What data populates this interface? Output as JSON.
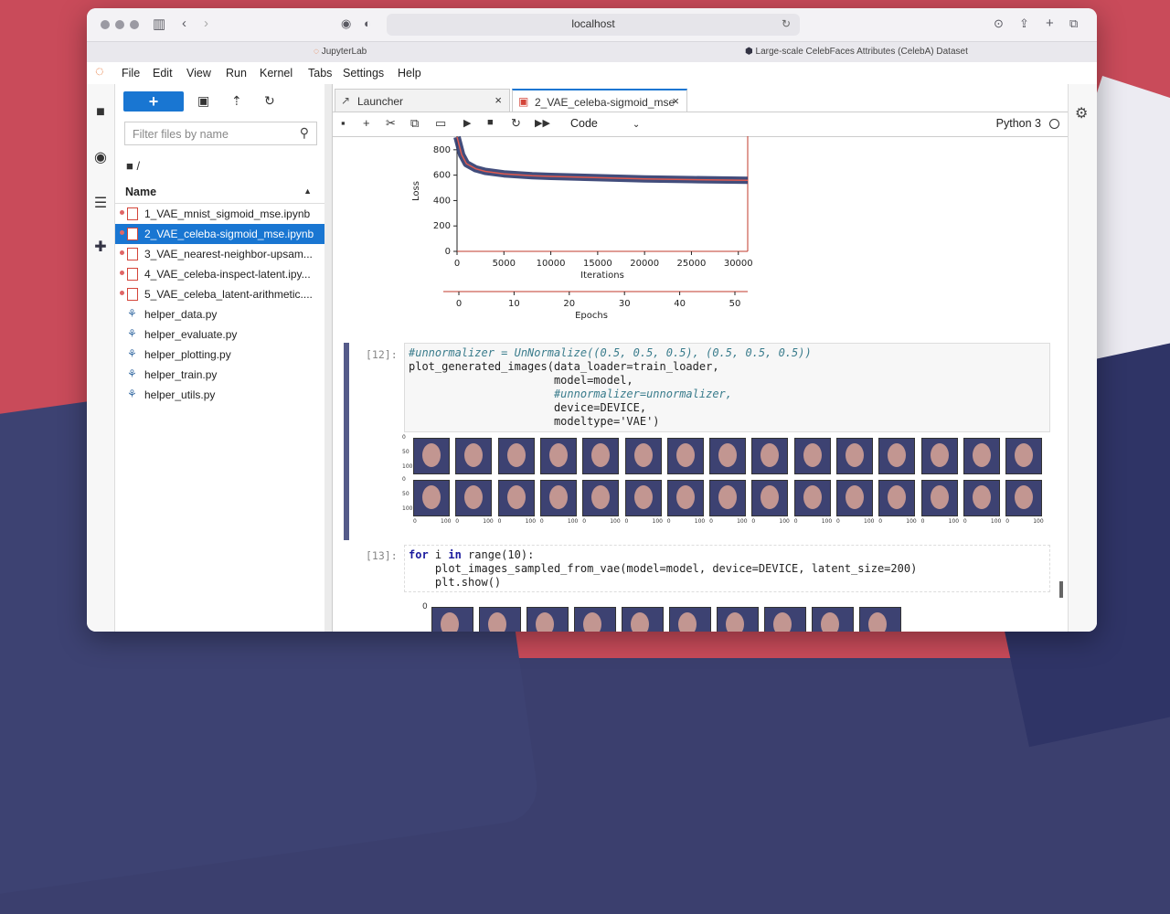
{
  "browser": {
    "url": "localhost",
    "tab_left": "JupyterLab",
    "tab_right": "Large-scale CelebFaces Attributes (CelebA) Dataset"
  },
  "menu": [
    "File",
    "Edit",
    "View",
    "Run",
    "Kernel",
    "Tabs",
    "Settings",
    "Help"
  ],
  "file_browser": {
    "filter_placeholder": "Filter files by name",
    "path": "/",
    "column_name": "Name",
    "files": [
      {
        "name": "1_VAE_mnist_sigmoid_mse.ipynb",
        "type": "notebook",
        "running": true,
        "selected": false
      },
      {
        "name": "2_VAE_celeba-sigmoid_mse.ipynb",
        "type": "notebook",
        "running": true,
        "selected": true
      },
      {
        "name": "3_VAE_nearest-neighbor-upsam...",
        "type": "notebook",
        "running": true,
        "selected": false
      },
      {
        "name": "4_VAE_celeba-inspect-latent.ipy...",
        "type": "notebook",
        "running": true,
        "selected": false
      },
      {
        "name": "5_VAE_celeba_latent-arithmetic....",
        "type": "notebook",
        "running": true,
        "selected": false
      },
      {
        "name": "helper_data.py",
        "type": "python"
      },
      {
        "name": "helper_evaluate.py",
        "type": "python"
      },
      {
        "name": "helper_plotting.py",
        "type": "python"
      },
      {
        "name": "helper_train.py",
        "type": "python"
      },
      {
        "name": "helper_utils.py",
        "type": "python"
      }
    ]
  },
  "doc_tabs": {
    "launcher": "Launcher",
    "notebook": "2_VAE_celeba-sigmoid_mse"
  },
  "toolbar": {
    "cell_type": "Code",
    "kernel": "Python 3"
  },
  "chart_data": {
    "type": "line",
    "ylabel": "Loss",
    "xlabel": "Iterations",
    "xlabel2": "Epochs",
    "yticks": [
      "0",
      "200",
      "400",
      "600",
      "800"
    ],
    "xticks": [
      "0",
      "5000",
      "10000",
      "15000",
      "20000",
      "25000",
      "30000"
    ],
    "xticks2": [
      "0",
      "10",
      "20",
      "30",
      "40",
      "50"
    ],
    "xlim": [
      0,
      31000
    ],
    "ylim": [
      0,
      950
    ],
    "series": [
      {
        "x": [
          0,
          500,
          1000,
          2000,
          3000,
          5000,
          8000,
          10000,
          15000,
          20000,
          25000,
          31000
        ],
        "values": [
          900,
          760,
          690,
          650,
          630,
          610,
          595,
          590,
          580,
          570,
          565,
          560
        ]
      }
    ]
  },
  "cells": {
    "c12_prompt": "[12]:",
    "c12_line1": "#unnormalizer = UnNormalize((0.5, 0.5, 0.5), (0.5, 0.5, 0.5))",
    "c12_line2": "plot_generated_images(data_loader=train_loader,",
    "c12_line3": "                      model=model,",
    "c12_line4": "                      #unnormalizer=unnormalizer,",
    "c12_line5": "                      device=DEVICE,",
    "c12_line6": "                      modeltype='VAE')",
    "c13_prompt": "[13]:",
    "c13_line1_kw": "for",
    "c13_line1_rest": " i ",
    "c13_line1_in": "in",
    "c13_line1_end": " range(10):",
    "c13_line2": "    plot_images_sampled_from_vae(model=model, device=DEVICE, latent_size=200)",
    "c13_line3": "    plt.show()"
  },
  "image_ticks": {
    "y": [
      "0",
      "50",
      "100"
    ],
    "x": [
      "0",
      "100"
    ],
    "sample_y0": "0"
  }
}
